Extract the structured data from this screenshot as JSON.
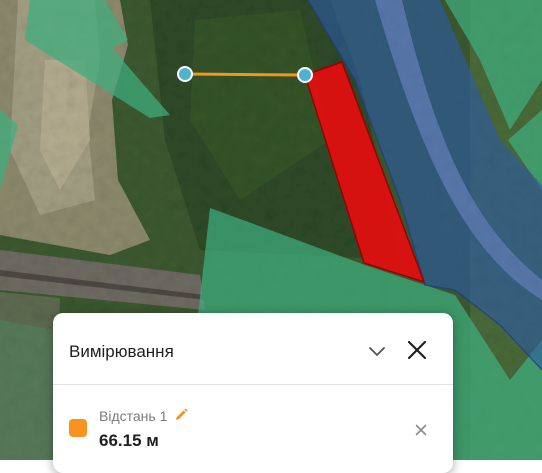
{
  "map": {
    "colors": {
      "zone_green": "#3fae7e",
      "zone_blue": "#2b5aa8",
      "parcel_red": "#e01010",
      "measure_line": "#f7931e",
      "measure_point": "#4fb3d0"
    }
  },
  "panel": {
    "title": "Вимірювання",
    "collapse_icon": "chevron-down-icon",
    "close_icon": "close-icon",
    "measurements": [
      {
        "name": "Відстань 1",
        "value": "66.15 м",
        "color": "#f7931e",
        "edit_icon": "pencil-icon",
        "remove_icon": "close-icon"
      }
    ]
  }
}
